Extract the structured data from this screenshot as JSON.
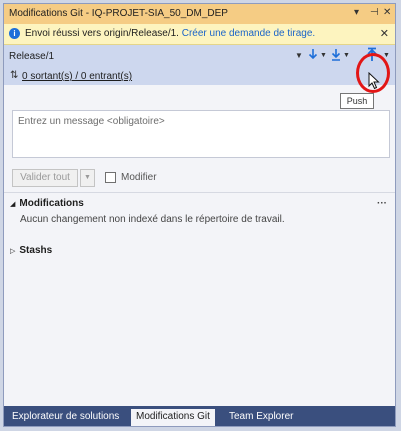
{
  "window": {
    "title": "Modifications Git - IQ-PROJET-SIA_50_DM_DEP",
    "controls": [
      "▾",
      "⊣",
      "✕"
    ]
  },
  "notification": {
    "icon": "info-icon",
    "text": "Envoi réussi vers origin/Release/1.",
    "link": "Créer une demande de tirage.",
    "close": "✕"
  },
  "branch": {
    "name": "Release/1",
    "caret": "▼"
  },
  "toolbar": {
    "actions": [
      {
        "name": "fetch",
        "icon": "fetch-arrow-icon"
      },
      {
        "name": "pull",
        "icon": "pull-arrow-icon"
      },
      {
        "name": "push",
        "icon": "push-arrow-icon"
      }
    ]
  },
  "sync": {
    "icon": "⇅",
    "label": "0 sortant(s) / 0 entrant(s)"
  },
  "commit": {
    "placeholder": "Entrez un message <obligatoire>",
    "commit_all": "Valider tout",
    "amend": "Modifier"
  },
  "sections": {
    "changes": {
      "title": "Modifications",
      "more": "···",
      "empty_text": "Aucun changement non indexé dans le répertoire de travail."
    },
    "stashes": {
      "title": "Stashs"
    }
  },
  "tooltip": "Push",
  "bottom_tabs": [
    {
      "label": "Explorateur de solutions",
      "active": false
    },
    {
      "label": "Modifications Git",
      "active": true
    },
    {
      "label": "Team Explorer",
      "active": false
    }
  ],
  "colors": {
    "title_bar": "#f5cc84",
    "notification_bg": "#fdf4bf",
    "branch_bar": "#cdd7ee",
    "accent_blue": "#1e6fd9",
    "highlight_red": "#e21616",
    "tab_bar": "#3a4f7e"
  }
}
